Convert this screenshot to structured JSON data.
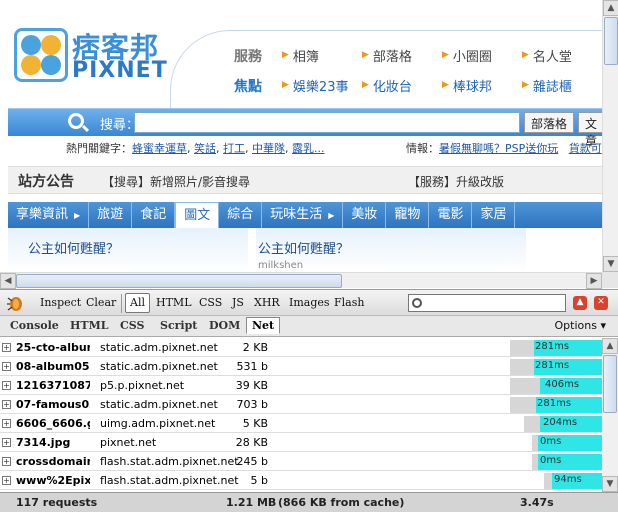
{
  "logo": {
    "brand": "痞客邦",
    "latin": "PIXNET"
  },
  "header": {
    "row1": {
      "category": "服務",
      "links": [
        "相簿",
        "部落格",
        "小圈圈",
        "名人堂"
      ]
    },
    "row2": {
      "category": "焦點",
      "links": [
        "娛樂23事",
        "化妝台",
        "棒球邦",
        "雜誌櫃"
      ]
    }
  },
  "search": {
    "label": "搜尋：",
    "value": "",
    "buttons": [
      "部落格",
      "文章"
    ]
  },
  "hot": {
    "prefix": "熱門關鍵字：",
    "keywords": [
      "蜂蜜幸運草",
      "笑話",
      "打工",
      "中華隊",
      "露乳..."
    ],
    "info_label": "情報：",
    "info_links": [
      "暑假無聊嗎？PSP送你玩",
      "貨款可"
    ]
  },
  "notice": {
    "title": "站方公告",
    "items": [
      "【搜尋】新增照片/影音搜尋",
      "【服務】升級改版"
    ]
  },
  "nav": {
    "tabs": [
      {
        "label": "享樂資訊",
        "arrow": true
      },
      {
        "label": "旅遊",
        "arrow": false
      },
      {
        "label": "食記",
        "arrow": false
      },
      {
        "label": "圖文",
        "arrow": false,
        "active": true
      },
      {
        "label": "綜合",
        "arrow": false
      },
      {
        "label": "玩味生活",
        "arrow": true
      },
      {
        "label": "美妝",
        "arrow": false
      },
      {
        "label": "寵物",
        "arrow": false
      },
      {
        "label": "電影",
        "arrow": false
      },
      {
        "label": "家居",
        "arrow": false
      }
    ]
  },
  "content": {
    "post1_title": "公主如何甦醒？",
    "post2_title": "公主如何甦醒？",
    "post2_author": "milkshen"
  },
  "firebug": {
    "toolbar": {
      "inspect": "Inspect",
      "clear": "Clear",
      "filters": [
        "All",
        "HTML",
        "CSS",
        "JS",
        "XHR",
        "Images",
        "Flash"
      ],
      "search_value": ""
    },
    "tabs": [
      "Console",
      "HTML",
      "CSS",
      "Script",
      "DOM",
      "Net"
    ],
    "active_tab": "Net",
    "options_label": "Options",
    "requests": [
      {
        "name": "25-cto-albun",
        "domain": "static.adm.pixnet.net",
        "size": "2 KB",
        "time": "281ms"
      },
      {
        "name": "08-album05.",
        "domain": "static.adm.pixnet.net",
        "size": "531 b",
        "time": "281ms"
      },
      {
        "name": "1216371087.",
        "domain": "p5.p.pixnet.net",
        "size": "39 KB",
        "time": "406ms"
      },
      {
        "name": "07-famous03",
        "domain": "static.adm.pixnet.net",
        "size": "703 b",
        "time": "281ms"
      },
      {
        "name": "6606_6606.g",
        "domain": "uimg.adm.pixnet.net",
        "size": "5 KB",
        "time": "204ms"
      },
      {
        "name": "7314.jpg",
        "domain": "pixnet.net",
        "size": "28 KB",
        "time": "0ms"
      },
      {
        "name": "crossdomain",
        "domain": "flash.stat.adm.pixnet.net",
        "size": "245 b",
        "time": "0ms"
      },
      {
        "name": "www%2Epixi",
        "domain": "flash.stat.adm.pixnet.net",
        "size": "5 b",
        "time": "94ms"
      }
    ],
    "footer": {
      "count": "117 requests",
      "size": "1.21 MB",
      "cache": "(866 KB from cache)",
      "total_time": "3.47s"
    }
  },
  "colors": {
    "accent_blue": "#3a86d6",
    "net_bar": "#2ee6e6",
    "link_arrow": "#e89b1e"
  }
}
